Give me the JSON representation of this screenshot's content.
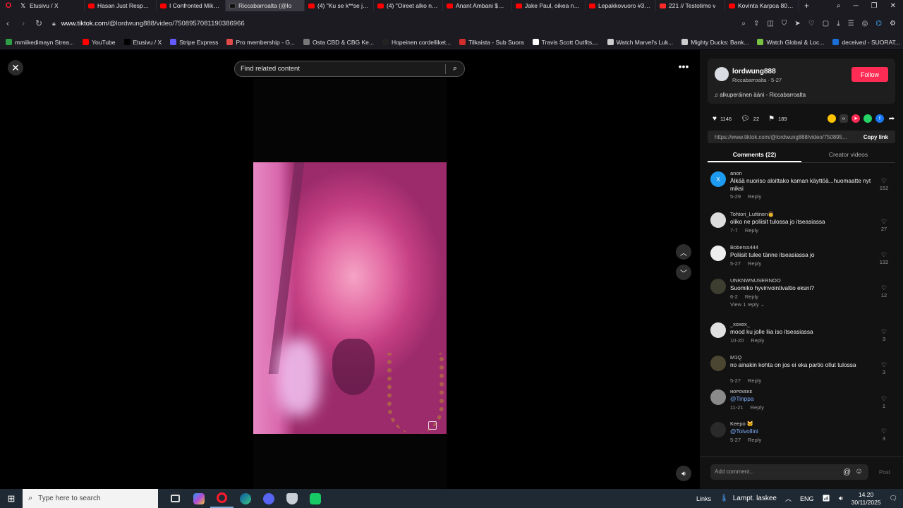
{
  "browser": {
    "tabs": [
      {
        "label": "Etusivu / X",
        "icon": "x-icon"
      },
      {
        "label": "Hasan Just Responde",
        "icon": "youtube-icon"
      },
      {
        "label": "I Confronted Mike M",
        "icon": "youtube-icon"
      },
      {
        "label": "Riccabarroalta (@lo",
        "icon": "tiktok-icon",
        "active": true
      },
      {
        "label": "(4) \"Ku se k**se ja p**s",
        "icon": "youtube-icon"
      },
      {
        "label": "(4) \"Oireet alko n. puo",
        "icon": "youtube-icon"
      },
      {
        "label": "Anant Ambani $30 Mi",
        "icon": "youtube-icon"
      },
      {
        "label": "Jake Paul, oikea nyrk",
        "icon": "youtube-icon"
      },
      {
        "label": "Lepakkovuoro #38 - ",
        "icon": "youtube-icon"
      },
      {
        "label": "221 // Testotimo v",
        "icon": "youtube-icon"
      },
      {
        "label": "Kovinta Karpoa 80-lu",
        "icon": "youtube-icon"
      }
    ],
    "url_host": "www.tiktok.com",
    "url_path": "/@lordwung888/video/7508957081190386966",
    "bookmarks": [
      {
        "label": "mmiikedimayn Strea...",
        "color": "#2e9e44"
      },
      {
        "label": "YouTube",
        "color": "#ff0000"
      },
      {
        "label": "Etusivu / X",
        "color": "#000000"
      },
      {
        "label": "Stripe Express",
        "color": "#635bff"
      },
      {
        "label": "Pro membership - G...",
        "color": "#e24a4a"
      },
      {
        "label": "Osta CBD & CBG Ke...",
        "color": "#777777"
      },
      {
        "label": "Hopeinen cordelliket...",
        "color": "#222222"
      },
      {
        "label": "Tilkaista - Sub Suora",
        "color": "#d22d2d"
      },
      {
        "label": "Travis Scott Outfits,...",
        "color": "#ffffff"
      },
      {
        "label": "Watch Marvel's Luk...",
        "color": "#cccccc"
      },
      {
        "label": "Mighty Ducks: Bank...",
        "color": "#cccccc"
      },
      {
        "label": "Watch Global & Loc...",
        "color": "#79c142"
      },
      {
        "label": "deceived - SUORAT...",
        "color": "#1a6fd9"
      }
    ]
  },
  "player": {
    "search_placeholder": "Find related content",
    "close_label": "✕",
    "more_label": "•••"
  },
  "author": {
    "username": "lordwung888",
    "display_line": "Riccabarroalta · 5-27",
    "follow_label": "Follow",
    "sound": "alkuperäinen ääni - Riccabarroalta"
  },
  "stats": {
    "likes": "1146",
    "comments": "22",
    "saves": "189"
  },
  "link": {
    "url": "https://www.tiktok.com/@lordwung888/video/7508957081190386966",
    "copy_label": "Copy link"
  },
  "panel_tabs": {
    "comments": "Comments (22)",
    "creator": "Creator videos"
  },
  "comments": [
    {
      "user": "anon",
      "text": "Älkää nuoriso aloittako kaman käyttöä...huomaatte nyt miksi",
      "date": "5-29",
      "reply": "Reply",
      "likes": "152",
      "avatar": "X",
      "avatar_color": "#1d9bf0"
    },
    {
      "user": "Tohtori_Luttinen👨",
      "text": "oliko ne poliisit tulossa jo itseasiassa",
      "date": "7-7",
      "reply": "Reply",
      "likes": "27",
      "avatar": "",
      "avatar_color": "#dcdcdc"
    },
    {
      "user": "Boberss444",
      "text": "Poliisit tulee tänne itseasiassa jo",
      "date": "5-27",
      "reply": "Reply",
      "likes": "132",
      "avatar": "",
      "avatar_color": "#eeeeee"
    },
    {
      "user": "UNKNWNUSERNOO",
      "text": "Suomiko hyvinvointivaltio eksni?",
      "date": "6-2",
      "reply": "Reply",
      "likes": "12",
      "avatar": "",
      "avatar_color": "#3d3d30",
      "view_replies": "View 1 reply ⌄"
    },
    {
      "user": "_xoxex_",
      "text": "mood ku jolle liia iso itseasiassa",
      "date": "10-20",
      "reply": "Reply",
      "likes": "3",
      "avatar": "",
      "avatar_color": "#e0e0e0"
    },
    {
      "user": "M1Q",
      "text": "no ainakin kohta on jos ei eka partio ollut tulossa",
      "date": "5-27",
      "reply": "Reply",
      "likes": "3",
      "avatar": "",
      "avatar_color": "#4a4632"
    },
    {
      "user": "ɴᴏᴘᴏᴠᴇᴋᴇ",
      "text": "@Tinppa",
      "date": "11-21",
      "reply": "Reply",
      "likes": "1",
      "avatar": "",
      "avatar_color": "#8a8a8a",
      "mention": true
    },
    {
      "user": "Keepo 🐱",
      "text": "@Toivollini",
      "date": "5-27",
      "reply": "Reply",
      "likes": "3",
      "avatar": "",
      "avatar_color": "#2a2a2a",
      "mention": true
    }
  ],
  "comment_box": {
    "placeholder": "Add comment...",
    "post_label": "Post"
  },
  "taskbar": {
    "search_placeholder": "Type here to search",
    "links_label": "Links",
    "weather": "Lampt. laskee",
    "language": "ENG",
    "time": "14.20",
    "date": "30/11/2025"
  }
}
